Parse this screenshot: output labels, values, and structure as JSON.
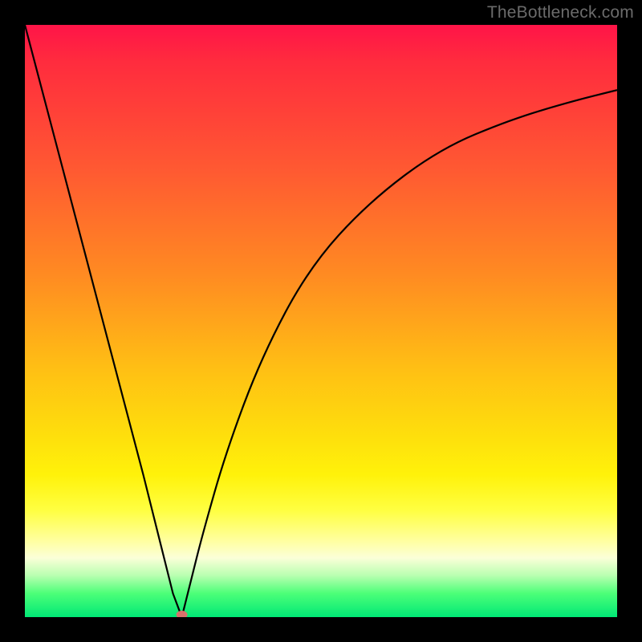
{
  "watermark": "TheBottleneck.com",
  "chart_data": {
    "type": "line",
    "title": "",
    "xlabel": "",
    "ylabel": "",
    "xlim": [
      0,
      100
    ],
    "ylim": [
      0,
      100
    ],
    "grid": false,
    "legend": false,
    "series": [
      {
        "name": "left-branch",
        "x": [
          0,
          5,
          10,
          15,
          20,
          23,
          25,
          26.5
        ],
        "values": [
          100,
          81,
          62,
          43,
          24,
          12,
          4,
          0
        ]
      },
      {
        "name": "right-branch",
        "x": [
          26.5,
          28,
          30,
          34,
          40,
          48,
          58,
          70,
          82,
          92,
          100
        ],
        "values": [
          0,
          6,
          14,
          28,
          44,
          59,
          70,
          79,
          84,
          87,
          89
        ]
      }
    ],
    "marker": {
      "x": 26.5,
      "y": 0,
      "color": "#d9716b"
    },
    "gradient_stops": [
      {
        "pos": 0,
        "color": "#ff1448"
      },
      {
        "pos": 24,
        "color": "#ff5832"
      },
      {
        "pos": 58,
        "color": "#ffbf14"
      },
      {
        "pos": 82,
        "color": "#ffff42"
      },
      {
        "pos": 100,
        "color": "#00e876"
      }
    ]
  }
}
